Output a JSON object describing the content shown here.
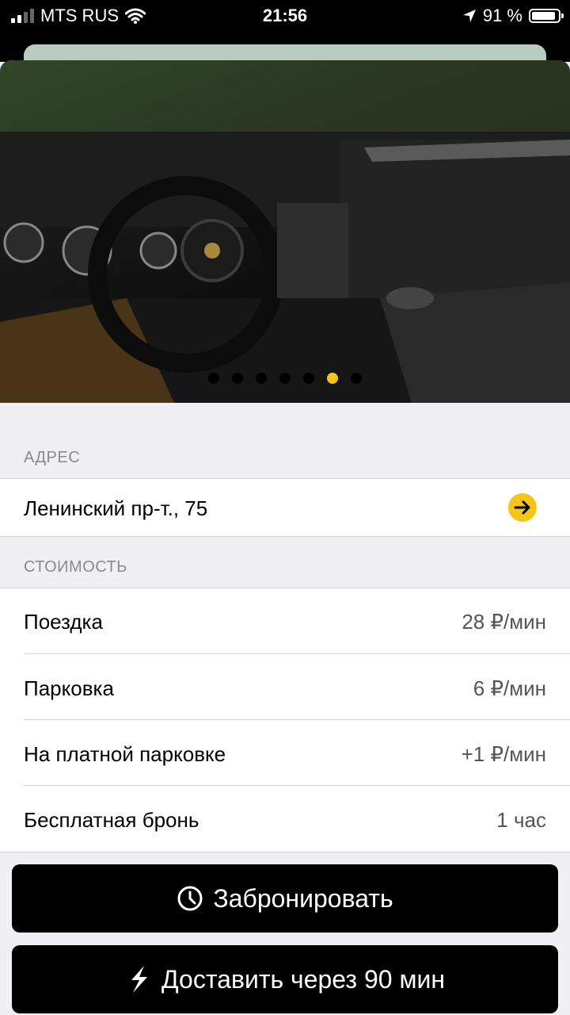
{
  "status_bar": {
    "carrier": "MTS RUS",
    "time": "21:56",
    "battery": "91 %",
    "battery_level": 0.91
  },
  "gallery": {
    "total_images": 7,
    "active_index": 5
  },
  "address": {
    "header": "АДРЕС",
    "text": "Ленинский пр-т., 75",
    "icon": "arrow-right-icon"
  },
  "pricing": {
    "header": "СТОИМОСТЬ",
    "rows": [
      {
        "label": "Поездка",
        "value": "28 ₽/мин"
      },
      {
        "label": "Парковка",
        "value": "6 ₽/мин"
      },
      {
        "label": "На платной парковке",
        "value": "+1 ₽/мин"
      },
      {
        "label": "Бесплатная бронь",
        "value": "1 час"
      }
    ]
  },
  "actions": {
    "book_label": "Забронировать",
    "book_icon": "clock-icon",
    "deliver_label": "Доставить через 90 мин",
    "deliver_icon": "lightning-icon"
  },
  "colors": {
    "accent": "#f5c518",
    "background": "#efeff4"
  }
}
